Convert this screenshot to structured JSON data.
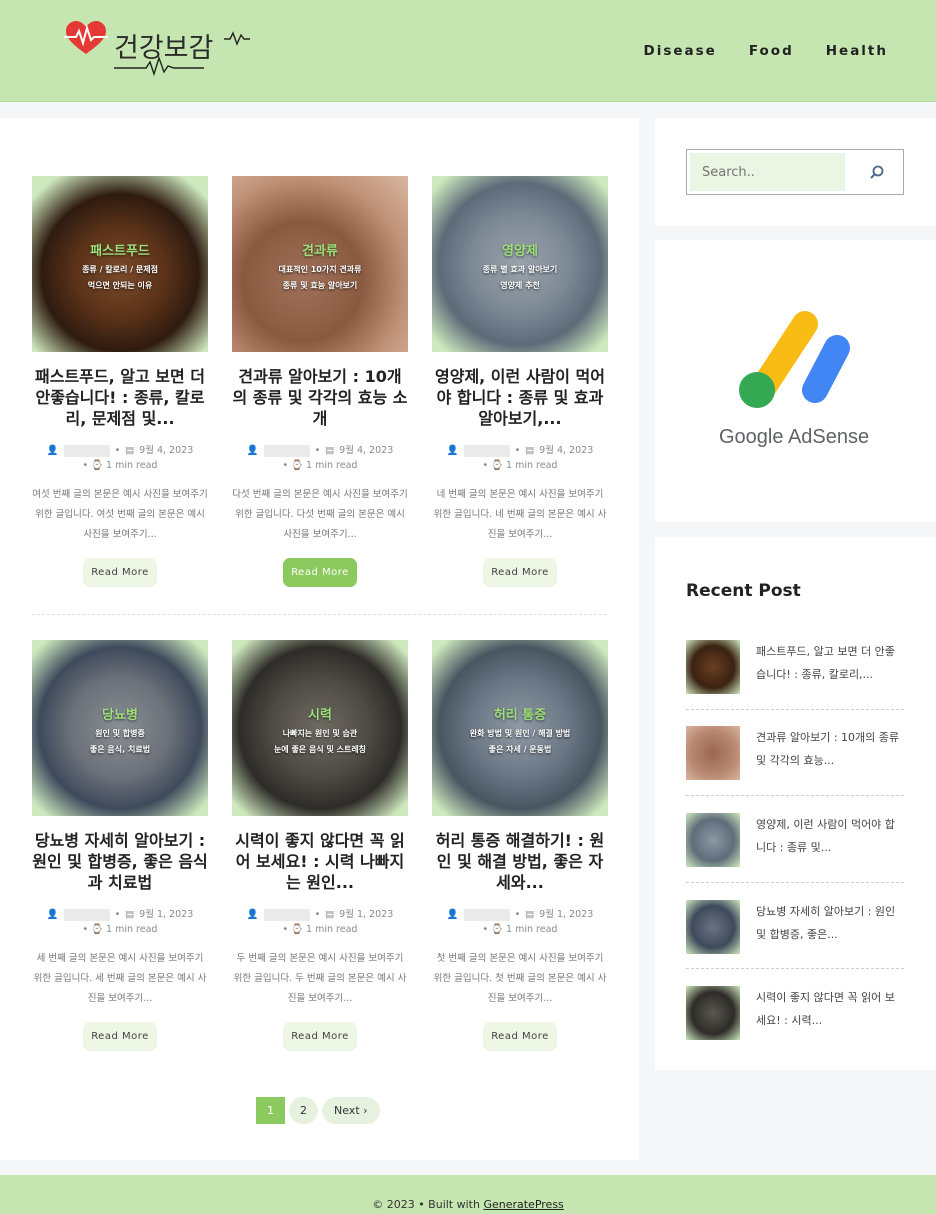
{
  "header": {
    "logo_text": "건강보감",
    "nav": [
      "Disease",
      "Food",
      "Health"
    ]
  },
  "posts": [
    {
      "category": "패스트푸드",
      "sub1": "종류 / 칼로리 / 문제점",
      "sub2": "먹으면 안되는 이유",
      "title": "패스트푸드, 알고 보면 더 안좋습니다! : 종류, 칼로리, 문제점 및...",
      "date": "9월 4, 2023",
      "read": "1 min read",
      "excerpt": "여섯 번째 글의 본문은 예시 사진을 보여주기 위한 글입니다. 여섯 번째 글의 본문은 예시 사진을 보여주기...",
      "more": "Read More"
    },
    {
      "category": "견과류",
      "sub1": "대표적인 10가지 견과류",
      "sub2": "종류 및 효능 알아보기",
      "title": "견과류 알아보기 : 10개의 종류 및 각각의 효능 소개",
      "date": "9월 4, 2023",
      "read": "1 min read",
      "excerpt": "다섯 번째 글의 본문은 예시 사진을 보여주기 위한 글입니다. 다섯 번째 글의 본문은 예시 사진을 보여주기...",
      "more": "Read More"
    },
    {
      "category": "영양제",
      "sub1": "종류 별 효과 알아보기",
      "sub2": "영양제 추천",
      "title": "영양제, 이런 사람이 먹어야 합니다 : 종류 및 효과 알아보기,...",
      "date": "9월 4, 2023",
      "read": "1 min read",
      "excerpt": "네 번째 글의 본문은 예시 사진을 보여주기 위한 글입니다. 네 번째 글의 본문은 예시 사진을 보여주기...",
      "more": "Read More"
    },
    {
      "category": "당뇨병",
      "sub1": "원인 및 합병증",
      "sub2": "좋은 음식, 치료법",
      "title": "당뇨병 자세히 알아보기 : 원인 및 합병증, 좋은 음식과 치료법",
      "date": "9월 1, 2023",
      "read": "1 min read",
      "excerpt": "세 번째 글의 본문은 예시 사진을 보여주기 위한 글입니다. 세 번째 글의 본문은 예시 사진을 보여주기...",
      "more": "Read More"
    },
    {
      "category": "시력",
      "sub1": "나빠지는 원인 및 습관",
      "sub2": "눈에 좋은 음식 및 스트레칭",
      "title": "시력이 좋지 않다면 꼭 읽어 보세요! : 시력 나빠지는 원인...",
      "date": "9월 1, 2023",
      "read": "1 min read",
      "excerpt": "두 번째 글의 본문은 예시 사진을 보여주기 위한 글입니다. 두 번째 글의 본문은 예시 사진을 보여주기...",
      "more": "Read More"
    },
    {
      "category": "허리 통증",
      "sub1": "완화 방법 및 원인 / 해결 방법",
      "sub2": "좋은 자세 / 운동법",
      "title": "허리 통증 해결하기! : 원인 및 해결 방법, 좋은 자세와...",
      "date": "9월 1, 2023",
      "read": "1 min read",
      "excerpt": "첫 번째 글의 본문은 예시 사진을 보여주기 위한 글입니다. 첫 번째 글의 본문은 예시 사진을 보여주기...",
      "more": "Read More"
    }
  ],
  "pagination": {
    "p1": "1",
    "p2": "2",
    "next": "Next"
  },
  "sidebar": {
    "search_placeholder": "Search..",
    "ads_text": "Google AdSense",
    "recent_title": "Recent Post",
    "recent": [
      "패스트푸드, 알고 보면 더 안좋습니다! : 종류, 칼로리,...",
      "견과류 알아보기 : 10개의 종류 및 각각의 효능...",
      "영양제, 이런 사람이 먹어야 합니다 : 종류 및...",
      "당뇨병 자세히 알아보기 : 원인 및 합병증, 좋은...",
      "시력이 좋지 않다면 꼭 읽어 보세요! : 시력..."
    ]
  },
  "footer": {
    "copyright": "© 2023 • Built with",
    "link": "GeneratePress"
  },
  "colors": {
    "brand_green": "#c5e6b0",
    "accent_green": "#8cc95f",
    "logo_red": "#e53935"
  },
  "icons": [
    "heart-pulse-icon",
    "search-icon",
    "user-icon",
    "calendar-icon",
    "clock-icon",
    "chevron-right-icon",
    "google-adsense-logo"
  ]
}
